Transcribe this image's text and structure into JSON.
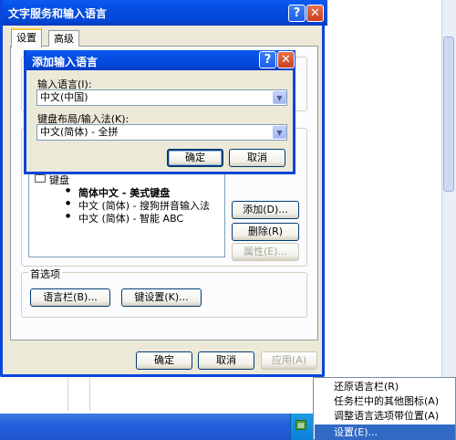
{
  "main_window": {
    "title": "文字服务和输入语言",
    "tabs": [
      {
        "label": "设置"
      },
      {
        "label": "高级"
      }
    ],
    "installed": {
      "keyboard_label": "键盘",
      "items": [
        "简体中文 - 美式键盘",
        "中文 (简体) - 搜狗拼音输入法",
        "中文 (简体) - 智能 ABC"
      ]
    },
    "buttons": {
      "add": "添加(D)...",
      "remove": "删除(R)",
      "properties": "属性(E)..."
    },
    "preferences": {
      "label": "首选项",
      "language_bar": "语言栏(B)...",
      "key_settings": "键设置(K)..."
    },
    "footer": {
      "ok": "确定",
      "cancel": "取消",
      "apply": "应用(A)"
    }
  },
  "dialog": {
    "title": "添加输入语言",
    "input_language_label": "输入语言(I):",
    "input_language_value": "中文(中国)",
    "keyboard_layout_label": "键盘布局/输入法(K):",
    "keyboard_layout_value": "中文(简体) - 全拼",
    "ok": "确定",
    "cancel": "取消"
  },
  "titlebar_buttons": {
    "help": "?",
    "close": "✕"
  },
  "context_menu": {
    "items": [
      "还原语言栏(R)",
      "任务栏中的其他图标(A)",
      "调整语言选项带位置(A)",
      "设置(E)..."
    ]
  },
  "colors": {
    "title_blue": "#0a46d8",
    "dialog_face": "#ece9d8",
    "menu_highlight": "#316ac5",
    "taskbar_blue": "#245edb"
  }
}
